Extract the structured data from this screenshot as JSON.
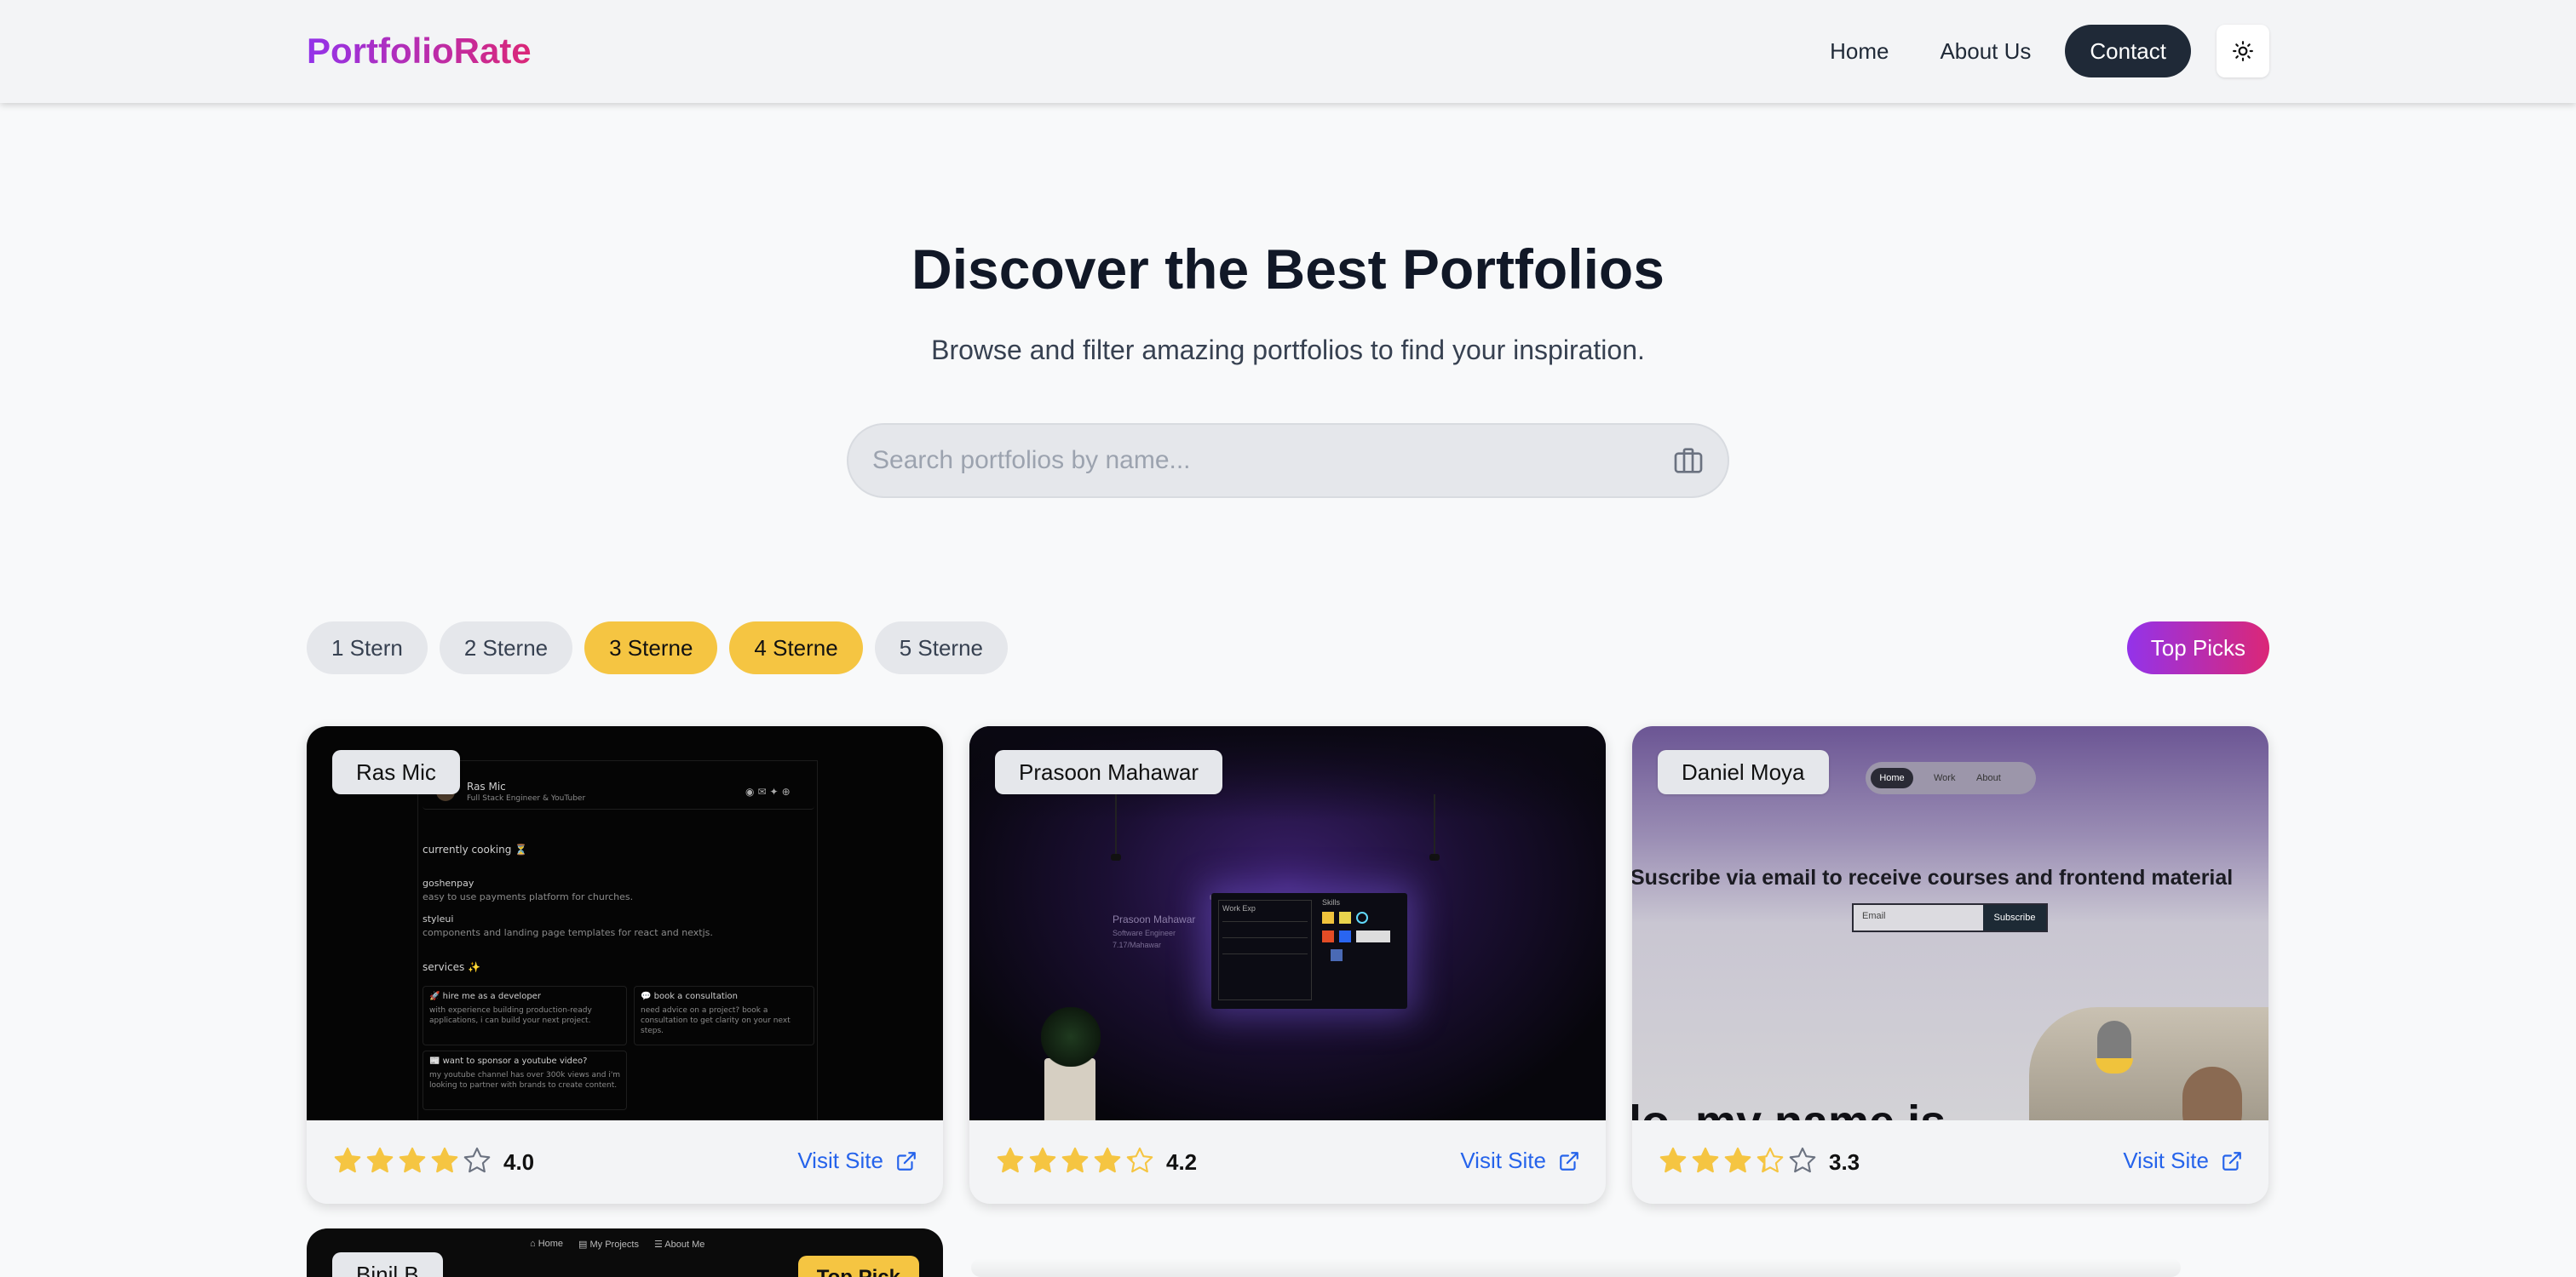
{
  "header": {
    "logo": "PortfolioRate",
    "nav": [
      "Home",
      "About Us",
      "Contact"
    ],
    "theme_icon": "sun-icon"
  },
  "hero": {
    "title": "Discover the Best Portfolios",
    "subtitle": "Browse and filter amazing portfolios to find your inspiration.",
    "search_placeholder": "Search portfolios by name...",
    "search_icon": "briefcase-icon"
  },
  "filters": {
    "chips": [
      {
        "label": "1 Stern",
        "active": false
      },
      {
        "label": "2 Sterne",
        "active": false
      },
      {
        "label": "3 Sterne",
        "active": true
      },
      {
        "label": "4 Sterne",
        "active": true
      },
      {
        "label": "5 Sterne",
        "active": false
      }
    ],
    "top_picks": "Top Picks"
  },
  "cards": [
    {
      "name": "Ras Mic",
      "rating": "4.0",
      "stars": 4.0,
      "visit": "Visit Site"
    },
    {
      "name": "Prasoon Mahawar",
      "rating": "4.2",
      "stars": 4.2,
      "visit": "Visit Site"
    },
    {
      "name": "Daniel Moya",
      "rating": "3.3",
      "stars": 3.3,
      "visit": "Visit Site"
    },
    {
      "name": "Binil B",
      "top_pick": "Top Pick"
    }
  ],
  "thumb1": {
    "name": "Ras Mic",
    "role": "Full Stack Engineer & YouTuber",
    "cooking": "currently cooking ⏳",
    "p1_title": "goshenpay",
    "p1_desc": "easy to use payments platform for churches.",
    "p2_title": "styleui",
    "p2_desc": "components and landing page templates for react and nextjs.",
    "services": "services ✨",
    "s1_title": "🚀 hire me as a developer",
    "s1_desc": "with experience building production-ready applications, i can build your next project.",
    "s2_title": "💬 book a consultation",
    "s2_desc": "need advice on a project? book a consultation to get clarity on your next steps.",
    "s3_title": "📰 want to sponsor a youtube video?",
    "s3_desc": "my youtube channel has over 300k views and i'm looking to partner with brands to create content."
  },
  "thumb2": {
    "name": "Prasoon Mahawar",
    "role": "Software Engineer",
    "handle": "7.17/Mahawar",
    "work": "Work Exp",
    "skills": "Skills"
  },
  "thumb3": {
    "nav": [
      "Home",
      "Work",
      "About"
    ],
    "headline": "Suscribe via email to receive courses and frontend material",
    "email_placeholder": "Email",
    "subscribe": "Subscribe",
    "hello": "lo, my name is"
  },
  "thumb4": {
    "nav": [
      "⌂ Home",
      "▤ My Projects",
      "☰ About Me"
    ]
  }
}
